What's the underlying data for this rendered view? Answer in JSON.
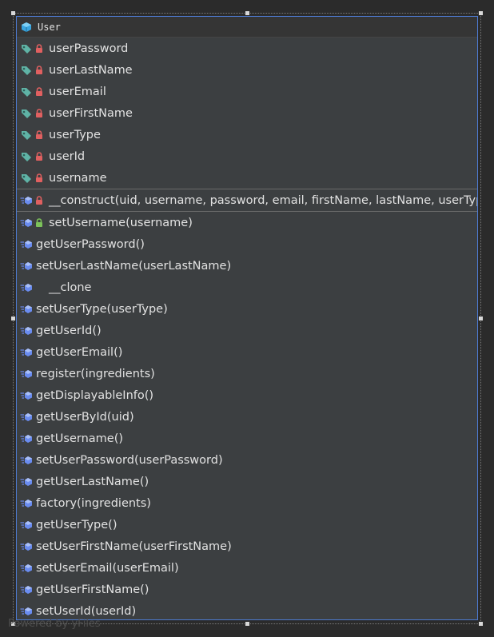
{
  "class_name": "User",
  "attributes": [
    "userPassword",
    "userLastName",
    "userEmail",
    "userFirstName",
    "userType",
    "userId",
    "username"
  ],
  "constructor": "__construct(uid, username, password, email, firstName, lastName, userType)",
  "methods": [
    {
      "text": "setUsername(username)",
      "lock": "green"
    },
    {
      "text": "getUserPassword()",
      "lock": "none"
    },
    {
      "text": "setUserLastName(userLastName)",
      "lock": "none"
    },
    {
      "text": "__clone",
      "lock": "blank"
    },
    {
      "text": "setUserType(userType)",
      "lock": "none"
    },
    {
      "text": "getUserId()",
      "lock": "none"
    },
    {
      "text": "getUserEmail()",
      "lock": "none"
    },
    {
      "text": "register(ingredients)",
      "lock": "none"
    },
    {
      "text": "getDisplayableInfo()",
      "lock": "none"
    },
    {
      "text": "getUserById(uid)",
      "lock": "none"
    },
    {
      "text": "getUsername()",
      "lock": "none"
    },
    {
      "text": "setUserPassword(userPassword)",
      "lock": "none"
    },
    {
      "text": "getUserLastName()",
      "lock": "none"
    },
    {
      "text": "factory(ingredients)",
      "lock": "none"
    },
    {
      "text": "getUserType()",
      "lock": "none"
    },
    {
      "text": "setUserFirstName(userFirstName)",
      "lock": "none"
    },
    {
      "text": "setUserEmail(userEmail)",
      "lock": "none"
    },
    {
      "text": "getUserFirstName()",
      "lock": "none"
    },
    {
      "text": "setUserId(userId)",
      "lock": "none"
    }
  ],
  "watermark": "Powered by yFiles",
  "colors": {
    "background": "#2b2b2b",
    "panel": "#3c3f41",
    "border_selected": "#4d7ad0",
    "tag_icon": "#5fb3a6",
    "private_lock": "#e06060",
    "public_lock": "#7cc25a",
    "method_icon": "#6a8cf0",
    "class_icon": "#3aa6e0"
  }
}
